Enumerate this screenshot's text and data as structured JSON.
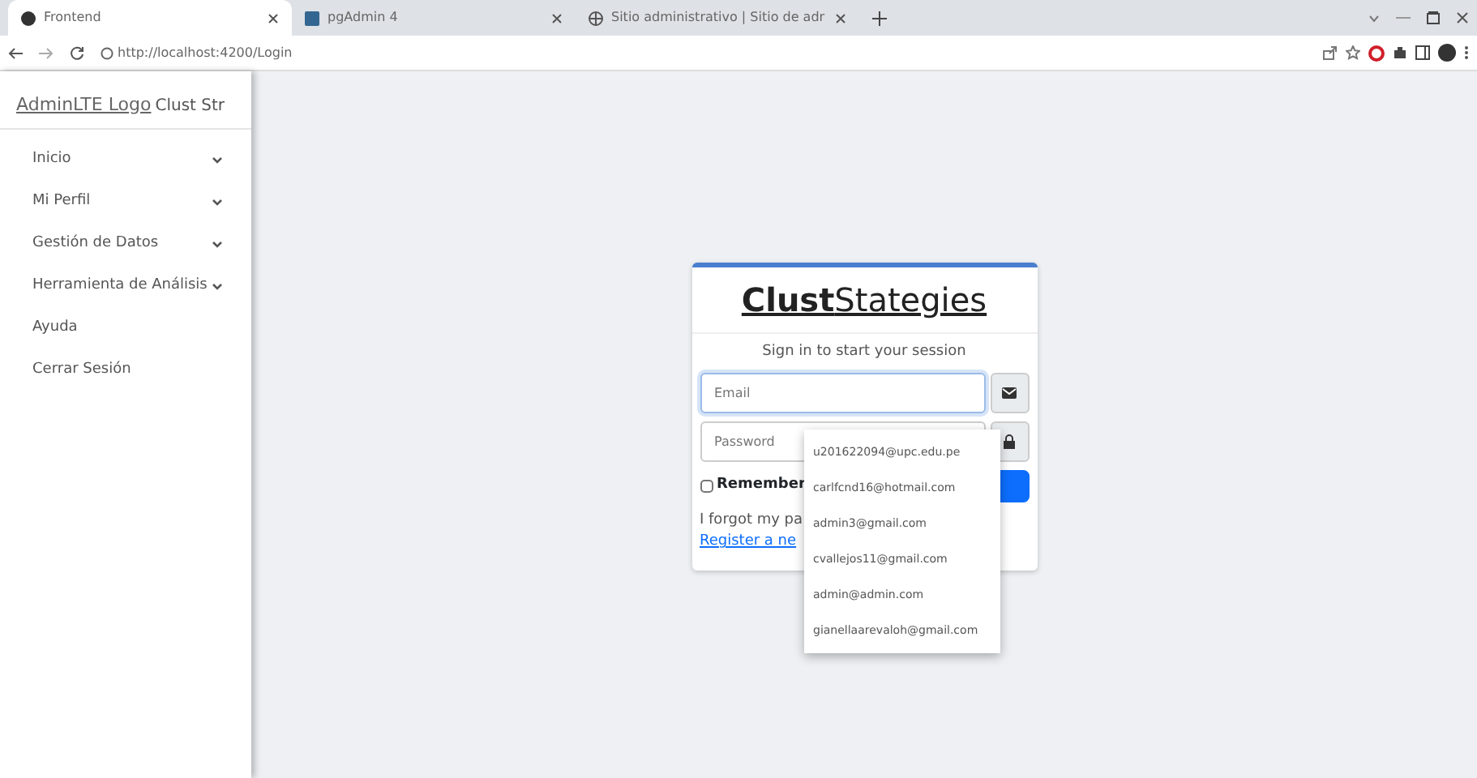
{
  "browser": {
    "tabs": [
      {
        "title": "Frontend",
        "selected": true
      },
      {
        "title": "pgAdmin 4",
        "selected": false
      },
      {
        "title": "Sitio administrativo | Sitio de adr",
        "selected": false
      }
    ],
    "url": "http://localhost:4200/Login"
  },
  "sidebar": {
    "logo_alt": "AdminLTE Logo",
    "brand": "Clust Str",
    "items": [
      {
        "label": "Inicio",
        "expandable": true
      },
      {
        "label": "Mi Perfil",
        "expandable": true
      },
      {
        "label": "Gestión de Datos",
        "expandable": true
      },
      {
        "label": "Herramienta de Análisis",
        "expandable": true
      },
      {
        "label": "Ayuda",
        "expandable": false
      },
      {
        "label": "Cerrar Sesión",
        "expandable": false
      }
    ]
  },
  "login": {
    "title_bold": "Clust",
    "title_rest": "Stategies",
    "message": "Sign in to start your session",
    "email": {
      "placeholder": "Email"
    },
    "password": {
      "placeholder": "Password"
    },
    "remember": {
      "label": "Remember",
      "checked": false
    },
    "forgot": "I forgot my pa",
    "register": "Register a ne"
  },
  "autocomplete": [
    "u201622094@upc.edu.pe",
    "carlfcnd16@hotmail.com",
    "admin3@gmail.com",
    "cvallejos11@gmail.com",
    "admin@admin.com",
    "gianellaarevaloh@gmail.com"
  ]
}
